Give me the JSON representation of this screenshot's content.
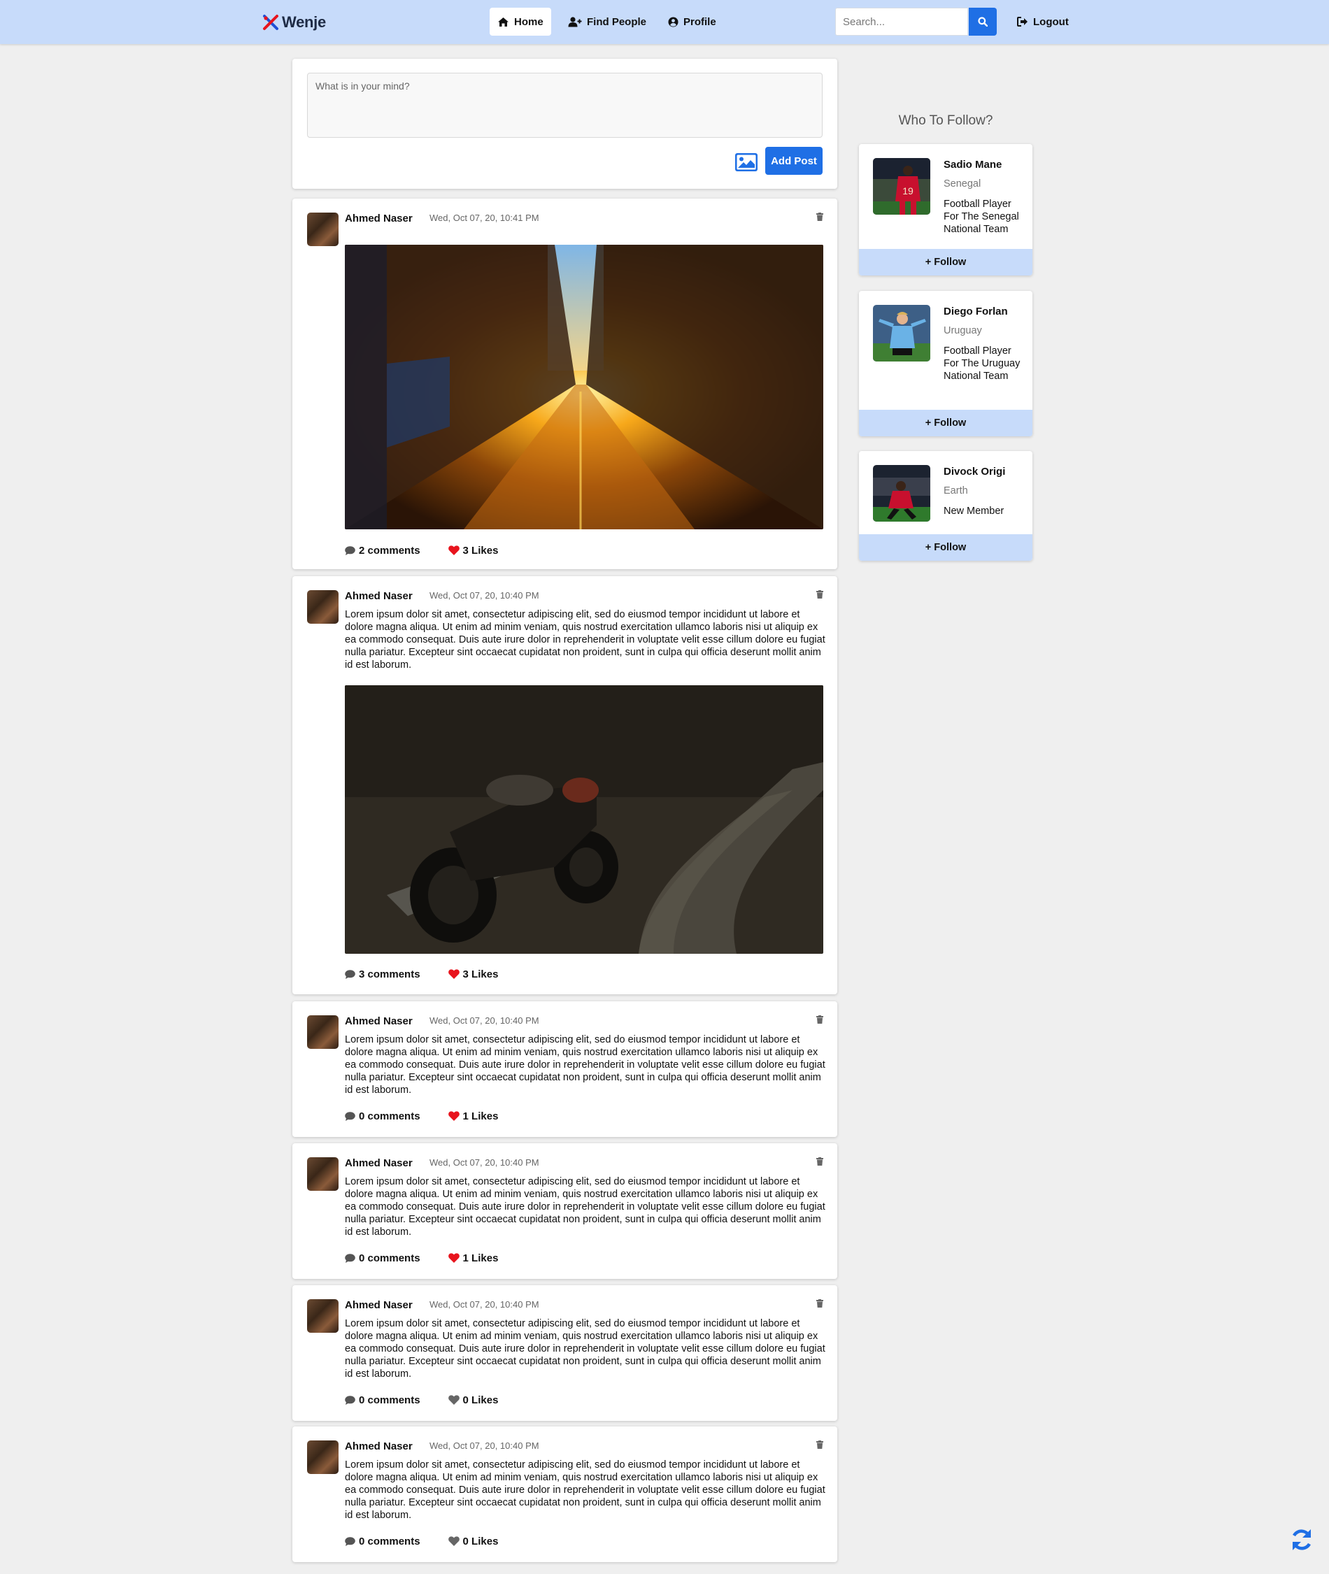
{
  "app": {
    "brand": "Wenje"
  },
  "nav": {
    "items": [
      {
        "label": "Home",
        "icon": "home-icon",
        "active": true
      },
      {
        "label": "Find People",
        "icon": "user-plus-icon",
        "active": false
      },
      {
        "label": "Profile",
        "icon": "user-circle-icon",
        "active": false
      }
    ],
    "search_placeholder": "Search...",
    "logout_label": "Logout"
  },
  "composer": {
    "placeholder": "What is in your mind?",
    "add_post_label": "Add Post"
  },
  "posts": [
    {
      "author": "Ahmed Naser",
      "date": "Wed, Oct 07, 20, 10:41 PM",
      "text": "",
      "image": "street-sunset",
      "comments": "2 comments",
      "likes": "3 Likes",
      "liked": true
    },
    {
      "author": "Ahmed Naser",
      "date": "Wed, Oct 07, 20, 10:40 PM",
      "text": "Lorem ipsum dolor sit amet, consectetur adipiscing elit, sed do eiusmod tempor incididunt ut labore et dolore magna aliqua. Ut enim ad minim veniam, quis nostrud exercitation ullamco laboris nisi ut aliquip ex ea commodo consequat. Duis aute irure dolor in reprehenderit in voluptate velit esse cillum dolore eu fugiat nulla pariatur. Excepteur sint occaecat cupidatat non proident, sunt in culpa qui officia deserunt mollit anim id est laborum.",
      "image": "motorcycle-forest",
      "comments": "3 comments",
      "likes": "3 Likes",
      "liked": true
    },
    {
      "author": "Ahmed Naser",
      "date": "Wed, Oct 07, 20, 10:40 PM",
      "text": "Lorem ipsum dolor sit amet, consectetur adipiscing elit, sed do eiusmod tempor incididunt ut labore et dolore magna aliqua. Ut enim ad minim veniam, quis nostrud exercitation ullamco laboris nisi ut aliquip ex ea commodo consequat. Duis aute irure dolor in reprehenderit in voluptate velit esse cillum dolore eu fugiat nulla pariatur. Excepteur sint occaecat cupidatat non proident, sunt in culpa qui officia deserunt mollit anim id est laborum.",
      "image": "",
      "comments": "0 comments",
      "likes": "1 Likes",
      "liked": true
    },
    {
      "author": "Ahmed Naser",
      "date": "Wed, Oct 07, 20, 10:40 PM",
      "text": "Lorem ipsum dolor sit amet, consectetur adipiscing elit, sed do eiusmod tempor incididunt ut labore et dolore magna aliqua. Ut enim ad minim veniam, quis nostrud exercitation ullamco laboris nisi ut aliquip ex ea commodo consequat. Duis aute irure dolor in reprehenderit in voluptate velit esse cillum dolore eu fugiat nulla pariatur. Excepteur sint occaecat cupidatat non proident, sunt in culpa qui officia deserunt mollit anim id est laborum.",
      "image": "",
      "comments": "0 comments",
      "likes": "1 Likes",
      "liked": true
    },
    {
      "author": "Ahmed Naser",
      "date": "Wed, Oct 07, 20, 10:40 PM",
      "text": "Lorem ipsum dolor sit amet, consectetur adipiscing elit, sed do eiusmod tempor incididunt ut labore et dolore magna aliqua. Ut enim ad minim veniam, quis nostrud exercitation ullamco laboris nisi ut aliquip ex ea commodo consequat. Duis aute irure dolor in reprehenderit in voluptate velit esse cillum dolore eu fugiat nulla pariatur. Excepteur sint occaecat cupidatat non proident, sunt in culpa qui officia deserunt mollit anim id est laborum.",
      "image": "",
      "comments": "0 comments",
      "likes": "0 Likes",
      "liked": false
    },
    {
      "author": "Ahmed Naser",
      "date": "Wed, Oct 07, 20, 10:40 PM",
      "text": "Lorem ipsum dolor sit amet, consectetur adipiscing elit, sed do eiusmod tempor incididunt ut labore et dolore magna aliqua. Ut enim ad minim veniam, quis nostrud exercitation ullamco laboris nisi ut aliquip ex ea commodo consequat. Duis aute irure dolor in reprehenderit in voluptate velit esse cillum dolore eu fugiat nulla pariatur. Excepteur sint occaecat cupidatat non proident, sunt in culpa qui officia deserunt mollit anim id est laborum.",
      "image": "",
      "comments": "0 comments",
      "likes": "0 Likes",
      "liked": false
    }
  ],
  "sidebar": {
    "title": "Who To Follow?",
    "people": [
      {
        "name": "Sadio Mane",
        "country": "Senegal",
        "bio": "Football Player For The Senegal National Team",
        "follow_label": "+ Follow",
        "avatar": "red-jersey-player"
      },
      {
        "name": "Diego Forlan",
        "country": "Uruguay",
        "bio": "Football Player For The Uruguay National Team",
        "follow_label": "+ Follow",
        "avatar": "sky-blue-jersey-player"
      },
      {
        "name": "Divock Origi",
        "country": "Earth",
        "bio": "New Member",
        "follow_label": "+ Follow",
        "avatar": "red-jersey-player-stadium"
      }
    ]
  },
  "colors": {
    "navbar": "#c7dbfa",
    "primary": "#1f6fe5",
    "like_active": "#e8141d",
    "like_inactive": "#666666",
    "page_bg": "#efefef"
  }
}
